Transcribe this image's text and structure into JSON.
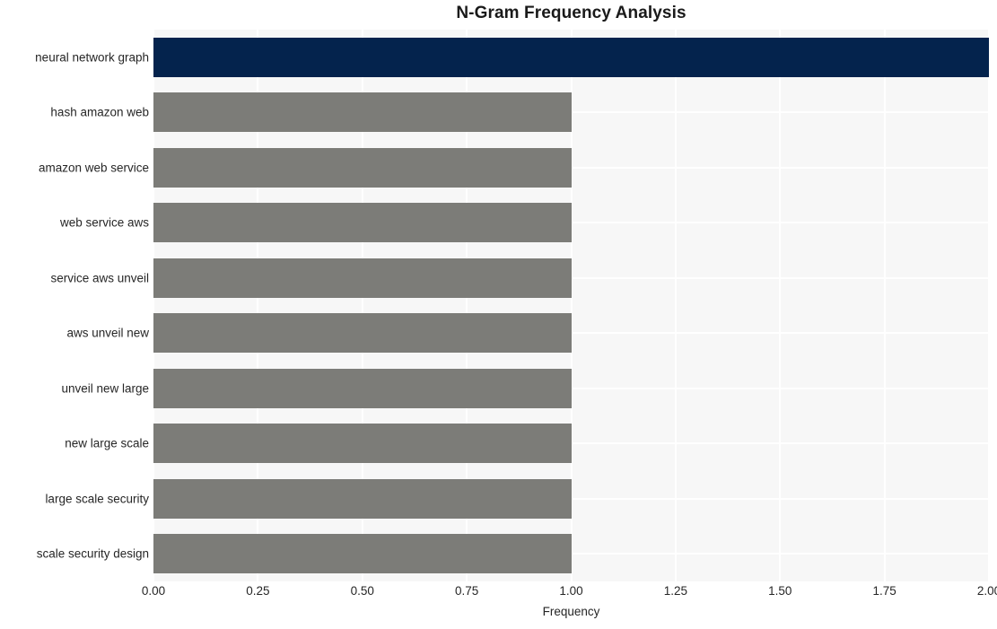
{
  "chart_data": {
    "type": "bar",
    "orientation": "horizontal",
    "title": "N-Gram Frequency Analysis",
    "xlabel": "Frequency",
    "ylabel": "",
    "xlim": [
      0,
      2
    ],
    "grid": true,
    "legend": "none",
    "xticks": [
      "0.00",
      "0.25",
      "0.50",
      "0.75",
      "1.00",
      "1.25",
      "1.50",
      "1.75",
      "2.00"
    ],
    "xtick_values": [
      0,
      0.25,
      0.5,
      0.75,
      1.0,
      1.25,
      1.5,
      1.75,
      2.0
    ],
    "categories": [
      "neural network graph",
      "hash amazon web",
      "amazon web service",
      "web service aws",
      "service aws unveil",
      "aws unveil new",
      "unveil new large",
      "new large scale",
      "large scale security",
      "scale security design"
    ],
    "values": [
      2,
      1,
      1,
      1,
      1,
      1,
      1,
      1,
      1,
      1
    ],
    "bar_colors": [
      "#04234d",
      "#7c7c78",
      "#7c7c78",
      "#7c7c78",
      "#7c7c78",
      "#7c7c78",
      "#7c7c78",
      "#7c7c78",
      "#7c7c78",
      "#7c7c78"
    ]
  },
  "style": {
    "plot_background": "#f7f7f7",
    "grid_color": "#ffffff",
    "page_background": "#ffffff",
    "text_color": "#262626",
    "title_color": "#1a1a1a"
  }
}
